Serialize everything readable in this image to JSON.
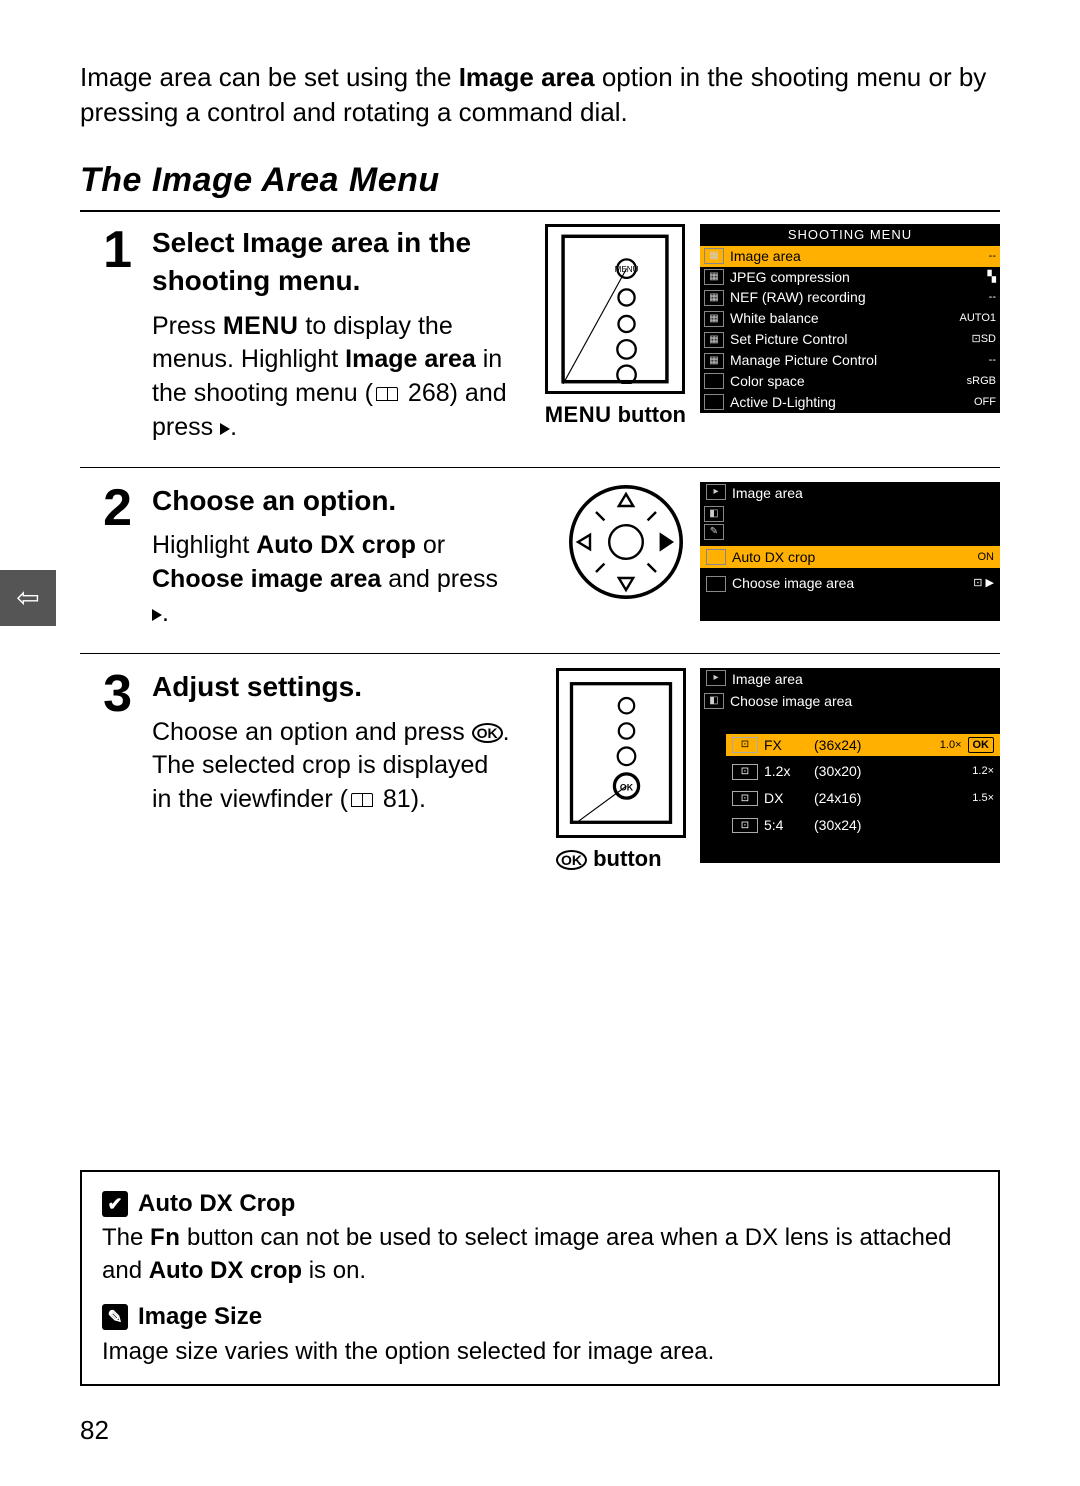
{
  "intro": {
    "prefix": "Image area can be set using the ",
    "bold1": "Image area",
    "suffix": " option in the shooting menu or by pressing a control and rotating a command dial."
  },
  "section_title": "The Image Area Menu",
  "side_tab_glyph": "⇦",
  "steps": [
    {
      "num": "1",
      "heading_pre": "Select ",
      "heading_bold": "Image area",
      "heading_post": " in the shooting menu.",
      "body_1": "Press ",
      "body_menu": "MENU",
      "body_2": " to display the menus. Highlight ",
      "body_bold": "Image area",
      "body_3": " in the shooting menu (",
      "body_page": " 268) and press ",
      "diagram_caption_pre": "MENU",
      "diagram_caption_post": " button",
      "lcd": {
        "title": "SHOOTING MENU",
        "rows": [
          {
            "label": "Image area",
            "val": "--",
            "hi": true
          },
          {
            "label": "JPEG compression",
            "val": "▚"
          },
          {
            "label": "NEF (RAW) recording",
            "val": "--"
          },
          {
            "label": "White balance",
            "val": "AUTO1"
          },
          {
            "label": "Set Picture Control",
            "val": "⊡SD"
          },
          {
            "label": "Manage Picture Control",
            "val": "--"
          },
          {
            "label": "Color space",
            "val": "sRGB"
          },
          {
            "label": "Active D-Lighting",
            "val": "OFF"
          }
        ]
      }
    },
    {
      "num": "2",
      "heading": "Choose an option.",
      "body_1": "Highlight ",
      "body_bold1": "Auto DX crop",
      "body_2": " or ",
      "body_bold2": "Choose image area",
      "body_3": " and press ",
      "lcd": {
        "header": "Image area",
        "rows": [
          {
            "label": "Auto DX crop",
            "val": "ON",
            "hi": true
          },
          {
            "label": "Choose image area",
            "val": "⊡ ▶"
          }
        ]
      }
    },
    {
      "num": "3",
      "heading": "Adjust settings.",
      "body_1": "Choose an option and press ",
      "body_2": ". The selected crop is displayed in the viewfinder (",
      "body_page": " 81).",
      "diagram_caption": " button",
      "lcd": {
        "header": "Image area",
        "subheader": "Choose image area",
        "rows": [
          {
            "fmt": "FX",
            "dim": "(36x24)",
            "mag": "1.0×",
            "hi": true,
            "ok": "OK"
          },
          {
            "fmt": "1.2x",
            "dim": "(30x20)",
            "mag": "1.2×"
          },
          {
            "fmt": "DX",
            "dim": "(24x16)",
            "mag": "1.5×"
          },
          {
            "fmt": "5:4",
            "dim": "(30x24)",
            "mag": ""
          }
        ]
      }
    }
  ],
  "notes": [
    {
      "mark": "✔",
      "title": "Auto DX Crop",
      "body_pre": "The ",
      "body_fn": "Fn",
      "body_mid": " button can not be used to select image area when a DX lens is attached and ",
      "body_bold": "Auto DX crop",
      "body_post": " is on."
    },
    {
      "mark": "✎",
      "title": "Image Size",
      "body": "Image size varies with the option selected for image area."
    }
  ],
  "page_number": "82"
}
